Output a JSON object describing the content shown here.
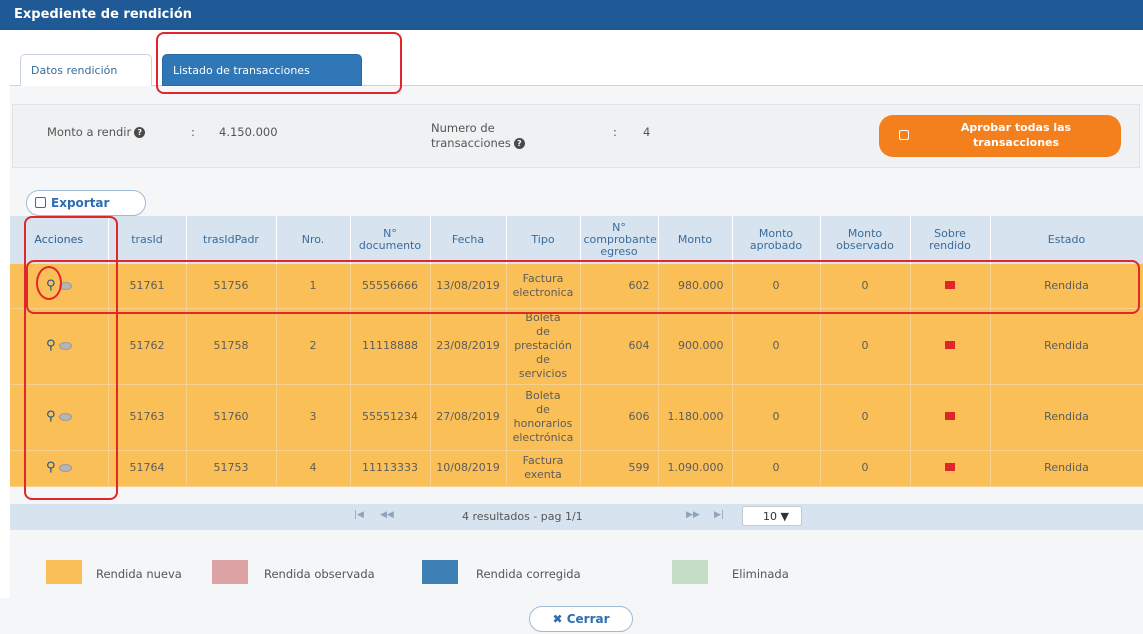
{
  "window": {
    "title": "Expediente de rendición"
  },
  "tabs": [
    {
      "label": "Datos rendición"
    },
    {
      "label": "Listado de transacciones"
    }
  ],
  "summary": {
    "monto_label": "Monto a rendir",
    "monto_sep": ":",
    "monto_value": "4.150.000",
    "numero_label_1": "Numero de",
    "numero_label_2": "transacciones",
    "numero_sep": ":",
    "numero_value": "4",
    "approve_line1": "Aprobar todas las",
    "approve_line2": "transacciones"
  },
  "export_label": "Exportar",
  "table": {
    "headers": [
      {
        "l1": "Acciones",
        "l2": ""
      },
      {
        "l1": "trasId",
        "l2": ""
      },
      {
        "l1": "trasIdPadr",
        "l2": ""
      },
      {
        "l1": "Nro.",
        "l2": ""
      },
      {
        "l1": "N°",
        "l2": "documento"
      },
      {
        "l1": "Fecha",
        "l2": ""
      },
      {
        "l1": "Tipo",
        "l2": ""
      },
      {
        "l1": "N°",
        "l2": "comprobante egreso"
      },
      {
        "l1": "Monto",
        "l2": ""
      },
      {
        "l1": "Monto",
        "l2": "aprobado"
      },
      {
        "l1": "Monto",
        "l2": "observado"
      },
      {
        "l1": "Sobre",
        "l2": "rendido"
      },
      {
        "l1": "Estado",
        "l2": ""
      }
    ],
    "rows": [
      {
        "trasId": "51761",
        "trasIdPadre": "51756",
        "nro": "1",
        "documento": "55556666",
        "fecha": "13/08/2019",
        "tipo": [
          "Factura",
          "electronica"
        ],
        "comprobante": "602",
        "monto": "980.000",
        "aprobado": "0",
        "observado": "0",
        "estado": "Rendida"
      },
      {
        "trasId": "51762",
        "trasIdPadre": "51758",
        "nro": "2",
        "documento": "11118888",
        "fecha": "23/08/2019",
        "tipo": [
          "Boleta",
          "de",
          "prestación",
          "de",
          "servicios"
        ],
        "comprobante": "604",
        "monto": "900.000",
        "aprobado": "0",
        "observado": "0",
        "estado": "Rendida"
      },
      {
        "trasId": "51763",
        "trasIdPadre": "51760",
        "nro": "3",
        "documento": "55551234",
        "fecha": "27/08/2019",
        "tipo": [
          "Boleta",
          "de",
          "honorarios",
          "electrónica"
        ],
        "comprobante": "606",
        "monto": "1.180.000",
        "aprobado": "0",
        "observado": "0",
        "estado": "Rendida"
      },
      {
        "trasId": "51764",
        "trasIdPadre": "51753",
        "nro": "4",
        "documento": "11113333",
        "fecha": "10/08/2019",
        "tipo": [
          "Factura",
          "exenta"
        ],
        "comprobante": "599",
        "monto": "1.090.000",
        "aprobado": "0",
        "observado": "0",
        "estado": "Rendida"
      }
    ]
  },
  "pager": {
    "first": "|◀",
    "prev": "◀◀",
    "next": "▶▶",
    "last": "▶|",
    "info": "4 resultados - pag 1/1",
    "page_size": "10"
  },
  "legend": [
    {
      "label": "Rendida nueva",
      "color": "#fbbf58"
    },
    {
      "label": "Rendida observada",
      "color": "#dca2a4"
    },
    {
      "label": "Rendida corregida",
      "color": "#3d80b4"
    },
    {
      "label": "Eliminada",
      "color": "#c5dcc5"
    }
  ],
  "close_label": "Cerrar",
  "colors": {
    "header": "#1f5a96",
    "row": "#fbbf58",
    "approve": "#f47f1d",
    "annotation": "#e1262c"
  }
}
